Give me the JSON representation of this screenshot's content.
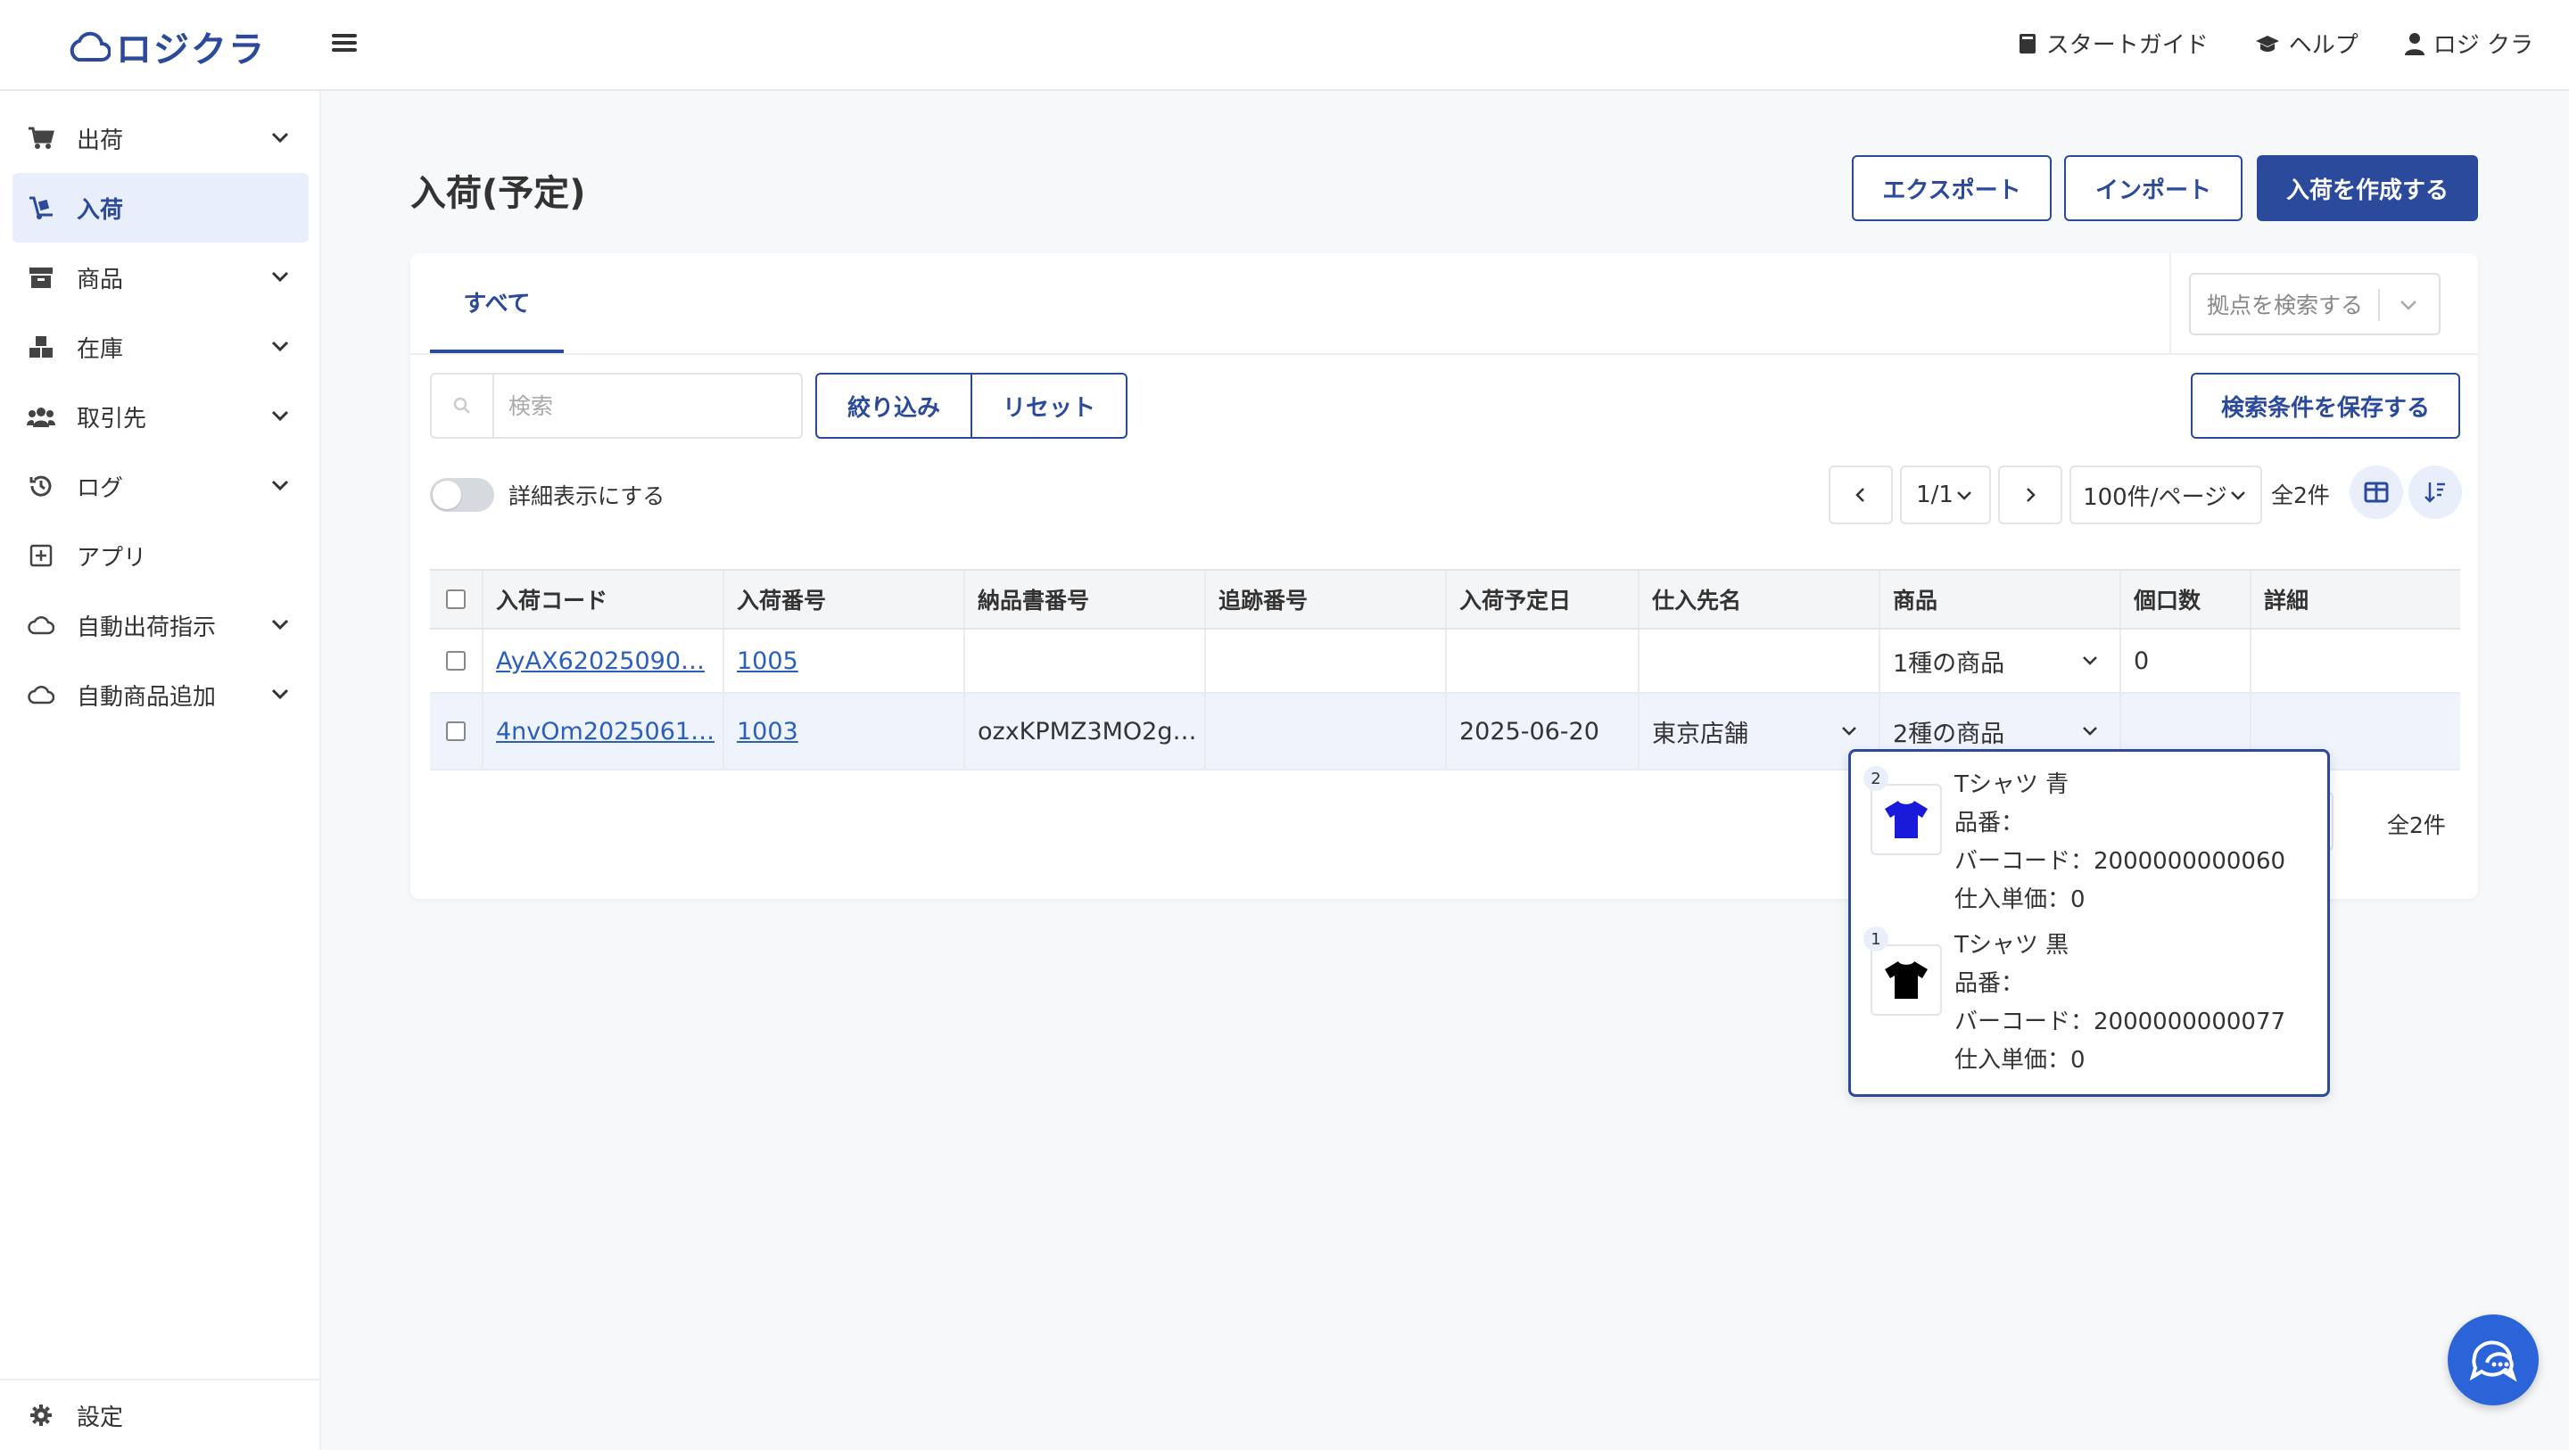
{
  "brand": {
    "logo_text": "ロジクラ"
  },
  "header": {
    "start_guide": "スタートガイド",
    "help": "ヘルプ",
    "user": "ロジ クラ"
  },
  "sidebar": {
    "items": [
      {
        "label": "出荷"
      },
      {
        "label": "入荷"
      },
      {
        "label": "商品"
      },
      {
        "label": "在庫"
      },
      {
        "label": "取引先"
      },
      {
        "label": "ログ"
      },
      {
        "label": "アプリ"
      },
      {
        "label": "自動出荷指示"
      },
      {
        "label": "自動商品追加"
      }
    ],
    "settings": "設定"
  },
  "page": {
    "title": "入荷(予定)",
    "export": "エクスポート",
    "import": "インポート",
    "create": "入荷を作成する"
  },
  "tabs": {
    "all": "すべて"
  },
  "location_select": {
    "placeholder": "拠点を検索する"
  },
  "search": {
    "placeholder": "検索"
  },
  "filters": {
    "narrow": "絞り込み",
    "reset": "リセット",
    "save": "検索条件を保存する",
    "detail_toggle": "詳細表示にする"
  },
  "pagination": {
    "page": "1/1",
    "per_page": "100件/ページ",
    "total": "全2件"
  },
  "table": {
    "headers": [
      "入荷コード",
      "入荷番号",
      "納品書番号",
      "追跡番号",
      "入荷予定日",
      "仕入先名",
      "商品",
      "個口数",
      "詳細"
    ],
    "rows": [
      {
        "code": "AyAX62025090…",
        "number": "1005",
        "invoice": "",
        "tracking": "",
        "date": "",
        "supplier": "",
        "products": "1種の商品",
        "packages": "0",
        "detail": ""
      },
      {
        "code": "4nvOm2025061…",
        "number": "1003",
        "invoice": "ozxKPMZ3MO2g…",
        "tracking": "",
        "date": "2025-06-20",
        "supplier": "東京店舗",
        "products": "2種の商品",
        "packages": "",
        "detail": ""
      }
    ]
  },
  "popup": {
    "products": [
      {
        "qty": "2",
        "name": "Tシャツ 青",
        "sku": "品番：",
        "barcode": "バーコード：2000000000060",
        "cost": "仕入単価：0",
        "color": "#1a1adb"
      },
      {
        "qty": "1",
        "name": "Tシャツ 黒",
        "sku": "品番：",
        "barcode": "バーコード：2000000000077",
        "cost": "仕入単価：0",
        "color": "#000000"
      }
    ]
  },
  "bottom": {
    "total": "全2件"
  },
  "colors": {
    "primary": "#2b4a9c",
    "highlight": "#eef3fc",
    "link": "#2b5fbe"
  }
}
